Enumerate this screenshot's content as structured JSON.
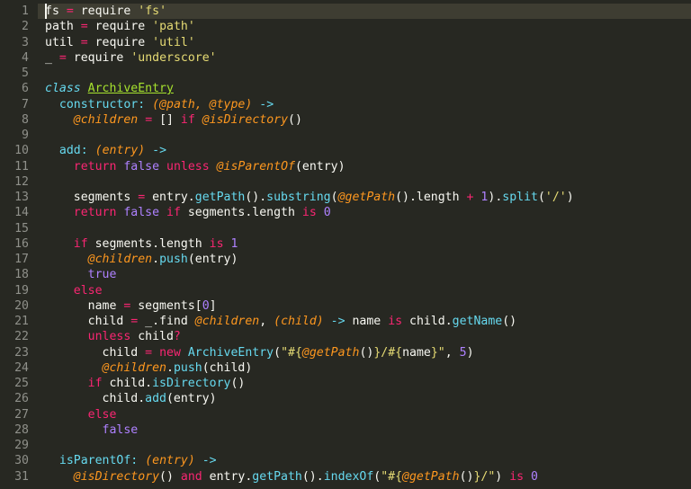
{
  "editor": {
    "highlighted_line": 1,
    "cursor": {
      "line": 1,
      "col": 0
    },
    "lines": [
      {
        "n": 1,
        "tokens": [
          [
            "t-nm",
            "fs "
          ],
          [
            "t-op",
            "="
          ],
          [
            "t-nm",
            " require "
          ],
          [
            "t-str",
            "'fs'"
          ]
        ]
      },
      {
        "n": 2,
        "tokens": [
          [
            "t-nm",
            "path "
          ],
          [
            "t-op",
            "="
          ],
          [
            "t-nm",
            " require "
          ],
          [
            "t-str",
            "'path'"
          ]
        ]
      },
      {
        "n": 3,
        "tokens": [
          [
            "t-nm",
            "util "
          ],
          [
            "t-op",
            "="
          ],
          [
            "t-nm",
            " require "
          ],
          [
            "t-str",
            "'util'"
          ]
        ]
      },
      {
        "n": 4,
        "tokens": [
          [
            "t-nm",
            "_ "
          ],
          [
            "t-op",
            "="
          ],
          [
            "t-nm",
            " require "
          ],
          [
            "t-str",
            "'underscore'"
          ]
        ]
      },
      {
        "n": 5,
        "tokens": [
          [
            "",
            ""
          ]
        ]
      },
      {
        "n": 6,
        "tokens": [
          [
            "t-fs",
            "class "
          ],
          [
            "t-cls",
            "ArchiveEntry"
          ]
        ]
      },
      {
        "n": 7,
        "tokens": [
          [
            "t-nm",
            "  "
          ],
          [
            "t-fn",
            "constructor"
          ],
          [
            "t-fn",
            ":"
          ],
          [
            "t-nm",
            " "
          ],
          [
            "t-par",
            "(@path, @type)"
          ],
          [
            "t-nm",
            " "
          ],
          [
            "t-fn",
            "->"
          ]
        ]
      },
      {
        "n": 8,
        "tokens": [
          [
            "t-nm",
            "    "
          ],
          [
            "t-par",
            "@children"
          ],
          [
            "t-nm",
            " "
          ],
          [
            "t-op",
            "="
          ],
          [
            "t-nm",
            " [] "
          ],
          [
            "t-op",
            "if"
          ],
          [
            "t-nm",
            " "
          ],
          [
            "t-par",
            "@isDirectory"
          ],
          [
            "t-nm",
            "()"
          ]
        ]
      },
      {
        "n": 9,
        "tokens": [
          [
            "",
            ""
          ]
        ]
      },
      {
        "n": 10,
        "tokens": [
          [
            "t-nm",
            "  "
          ],
          [
            "t-fn",
            "add"
          ],
          [
            "t-fn",
            ":"
          ],
          [
            "t-nm",
            " "
          ],
          [
            "t-par",
            "(entry)"
          ],
          [
            "t-nm",
            " "
          ],
          [
            "t-fn",
            "->"
          ]
        ]
      },
      {
        "n": 11,
        "tokens": [
          [
            "t-nm",
            "    "
          ],
          [
            "t-op",
            "return"
          ],
          [
            "t-nm",
            " "
          ],
          [
            "t-bool",
            "false"
          ],
          [
            "t-nm",
            " "
          ],
          [
            "t-op",
            "unless"
          ],
          [
            "t-nm",
            " "
          ],
          [
            "t-par",
            "@isParentOf"
          ],
          [
            "t-nm",
            "(entry)"
          ]
        ]
      },
      {
        "n": 12,
        "tokens": [
          [
            "",
            ""
          ]
        ]
      },
      {
        "n": 13,
        "tokens": [
          [
            "t-nm",
            "    segments "
          ],
          [
            "t-op",
            "="
          ],
          [
            "t-nm",
            " entry."
          ],
          [
            "t-fn",
            "getPath"
          ],
          [
            "t-nm",
            "()."
          ],
          [
            "t-fn",
            "substring"
          ],
          [
            "t-nm",
            "("
          ],
          [
            "t-par",
            "@getPath"
          ],
          [
            "t-nm",
            "().length "
          ],
          [
            "t-op",
            "+"
          ],
          [
            "t-nm",
            " "
          ],
          [
            "t-num",
            "1"
          ],
          [
            "t-nm",
            ")."
          ],
          [
            "t-fn",
            "split"
          ],
          [
            "t-nm",
            "("
          ],
          [
            "t-str",
            "'/'"
          ],
          [
            "t-nm",
            ")"
          ]
        ]
      },
      {
        "n": 14,
        "tokens": [
          [
            "t-nm",
            "    "
          ],
          [
            "t-op",
            "return"
          ],
          [
            "t-nm",
            " "
          ],
          [
            "t-bool",
            "false"
          ],
          [
            "t-nm",
            " "
          ],
          [
            "t-op",
            "if"
          ],
          [
            "t-nm",
            " segments.length "
          ],
          [
            "t-op",
            "is"
          ],
          [
            "t-nm",
            " "
          ],
          [
            "t-num",
            "0"
          ]
        ]
      },
      {
        "n": 15,
        "tokens": [
          [
            "",
            ""
          ]
        ]
      },
      {
        "n": 16,
        "tokens": [
          [
            "t-nm",
            "    "
          ],
          [
            "t-op",
            "if"
          ],
          [
            "t-nm",
            " segments.length "
          ],
          [
            "t-op",
            "is"
          ],
          [
            "t-nm",
            " "
          ],
          [
            "t-num",
            "1"
          ]
        ]
      },
      {
        "n": 17,
        "tokens": [
          [
            "t-nm",
            "      "
          ],
          [
            "t-par",
            "@children"
          ],
          [
            "t-nm",
            "."
          ],
          [
            "t-fn",
            "push"
          ],
          [
            "t-nm",
            "(entry)"
          ]
        ]
      },
      {
        "n": 18,
        "tokens": [
          [
            "t-nm",
            "      "
          ],
          [
            "t-bool",
            "true"
          ]
        ]
      },
      {
        "n": 19,
        "tokens": [
          [
            "t-nm",
            "    "
          ],
          [
            "t-op",
            "else"
          ]
        ]
      },
      {
        "n": 20,
        "tokens": [
          [
            "t-nm",
            "      name "
          ],
          [
            "t-op",
            "="
          ],
          [
            "t-nm",
            " segments["
          ],
          [
            "t-num",
            "0"
          ],
          [
            "t-nm",
            "]"
          ]
        ]
      },
      {
        "n": 21,
        "tokens": [
          [
            "t-nm",
            "      child "
          ],
          [
            "t-op",
            "="
          ],
          [
            "t-nm",
            " _.find "
          ],
          [
            "t-par",
            "@children"
          ],
          [
            "t-nm",
            ", "
          ],
          [
            "t-par",
            "(child)"
          ],
          [
            "t-nm",
            " "
          ],
          [
            "t-fn",
            "->"
          ],
          [
            "t-nm",
            " name "
          ],
          [
            "t-op",
            "is"
          ],
          [
            "t-nm",
            " child."
          ],
          [
            "t-fn",
            "getName"
          ],
          [
            "t-nm",
            "()"
          ]
        ]
      },
      {
        "n": 22,
        "tokens": [
          [
            "t-nm",
            "      "
          ],
          [
            "t-op",
            "unless"
          ],
          [
            "t-nm",
            " child"
          ],
          [
            "t-op",
            "?"
          ]
        ]
      },
      {
        "n": 23,
        "tokens": [
          [
            "t-nm",
            "        child "
          ],
          [
            "t-op",
            "="
          ],
          [
            "t-nm",
            " "
          ],
          [
            "t-op",
            "new"
          ],
          [
            "t-nm",
            " "
          ],
          [
            "t-fn",
            "ArchiveEntry"
          ],
          [
            "t-nm",
            "("
          ],
          [
            "t-str",
            "\"#{"
          ],
          [
            "t-par",
            "@getPath"
          ],
          [
            "t-nm",
            "()"
          ],
          [
            "t-str",
            "}/#{"
          ],
          [
            "t-nm",
            "name"
          ],
          [
            "t-str",
            "}\""
          ],
          [
            "t-nm",
            ", "
          ],
          [
            "t-num",
            "5"
          ],
          [
            "t-nm",
            ")"
          ]
        ]
      },
      {
        "n": 24,
        "tokens": [
          [
            "t-nm",
            "        "
          ],
          [
            "t-par",
            "@children"
          ],
          [
            "t-nm",
            "."
          ],
          [
            "t-fn",
            "push"
          ],
          [
            "t-nm",
            "(child)"
          ]
        ]
      },
      {
        "n": 25,
        "tokens": [
          [
            "t-nm",
            "      "
          ],
          [
            "t-op",
            "if"
          ],
          [
            "t-nm",
            " child."
          ],
          [
            "t-fn",
            "isDirectory"
          ],
          [
            "t-nm",
            "()"
          ]
        ]
      },
      {
        "n": 26,
        "tokens": [
          [
            "t-nm",
            "        child."
          ],
          [
            "t-fn",
            "add"
          ],
          [
            "t-nm",
            "(entry)"
          ]
        ]
      },
      {
        "n": 27,
        "tokens": [
          [
            "t-nm",
            "      "
          ],
          [
            "t-op",
            "else"
          ]
        ]
      },
      {
        "n": 28,
        "tokens": [
          [
            "t-nm",
            "        "
          ],
          [
            "t-bool",
            "false"
          ]
        ]
      },
      {
        "n": 29,
        "tokens": [
          [
            "",
            ""
          ]
        ]
      },
      {
        "n": 30,
        "tokens": [
          [
            "t-nm",
            "  "
          ],
          [
            "t-fn",
            "isParentOf"
          ],
          [
            "t-fn",
            ":"
          ],
          [
            "t-nm",
            " "
          ],
          [
            "t-par",
            "(entry)"
          ],
          [
            "t-nm",
            " "
          ],
          [
            "t-fn",
            "->"
          ]
        ]
      },
      {
        "n": 31,
        "tokens": [
          [
            "t-nm",
            "    "
          ],
          [
            "t-par",
            "@isDirectory"
          ],
          [
            "t-nm",
            "() "
          ],
          [
            "t-op",
            "and"
          ],
          [
            "t-nm",
            " entry."
          ],
          [
            "t-fn",
            "getPath"
          ],
          [
            "t-nm",
            "()."
          ],
          [
            "t-fn",
            "indexOf"
          ],
          [
            "t-nm",
            "("
          ],
          [
            "t-str",
            "\"#{"
          ],
          [
            "t-par",
            "@getPath"
          ],
          [
            "t-nm",
            "()"
          ],
          [
            "t-str",
            "}/\""
          ],
          [
            "t-nm",
            ") "
          ],
          [
            "t-op",
            "is"
          ],
          [
            "t-nm",
            " "
          ],
          [
            "t-num",
            "0"
          ]
        ]
      }
    ]
  }
}
